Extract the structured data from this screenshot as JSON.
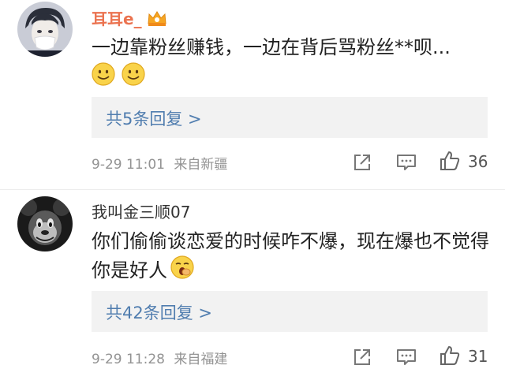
{
  "comments": [
    {
      "username": "耳耳e_",
      "text": "一边靠粉丝赚钱，一边在背后骂粉丝**呗...",
      "replies": "共5条回复 >",
      "time": "9-29 11:01",
      "location": "来自新疆",
      "likes": "36",
      "badge_icon": "crown-icon",
      "emoji_icon": "smile-emoji"
    },
    {
      "username": "我叫金三顺07",
      "text": "你们偷偷谈恋爱的时候咋不爆，现在爆也不觉得你是好人",
      "replies": "共42条回复 >",
      "time": "9-29 11:28",
      "location": "来自福建",
      "likes": "31",
      "emoji_icon": "yawn-emoji"
    }
  ],
  "colors": {
    "username_highlight": "#eb7350",
    "link": "#507daf",
    "meta": "#939393",
    "reply_bg": "#f2f2f2"
  }
}
